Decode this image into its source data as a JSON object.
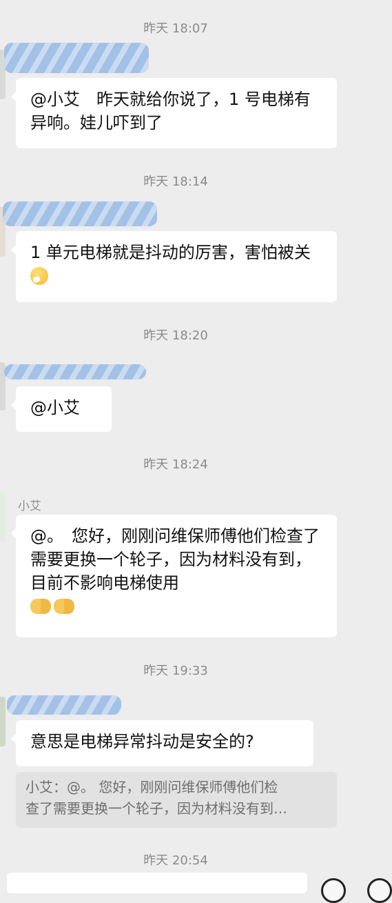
{
  "timestamps": [
    "昨天 18:07",
    "昨天 18:14",
    "昨天 18:20",
    "昨天 18:24",
    "昨天 19:33",
    "昨天 20:54"
  ],
  "messages": [
    {
      "text": "@小艾　昨天就给你说了，1 号电梯有异响。娃儿吓到了"
    },
    {
      "text": "1 单元电梯就是抖动的厉害，害怕被关",
      "emoji": "face-with-hand-over-mouth-emoji"
    },
    {
      "text": "@小艾"
    },
    {
      "sender": "小艾",
      "text": "@。　您好，刚刚问维保师傅他们检查了需要更换一个轮子，因为材料没有到，目前不影响电梯使用",
      "emoji": "handshake-emoji x2"
    },
    {
      "text": "意思是电梯异常抖动是安全的?",
      "quote": "小艾：@。 您好，刚刚问维保师傅他们检\n查了需要更换一个轮子，因为材料没有到…"
    }
  ]
}
